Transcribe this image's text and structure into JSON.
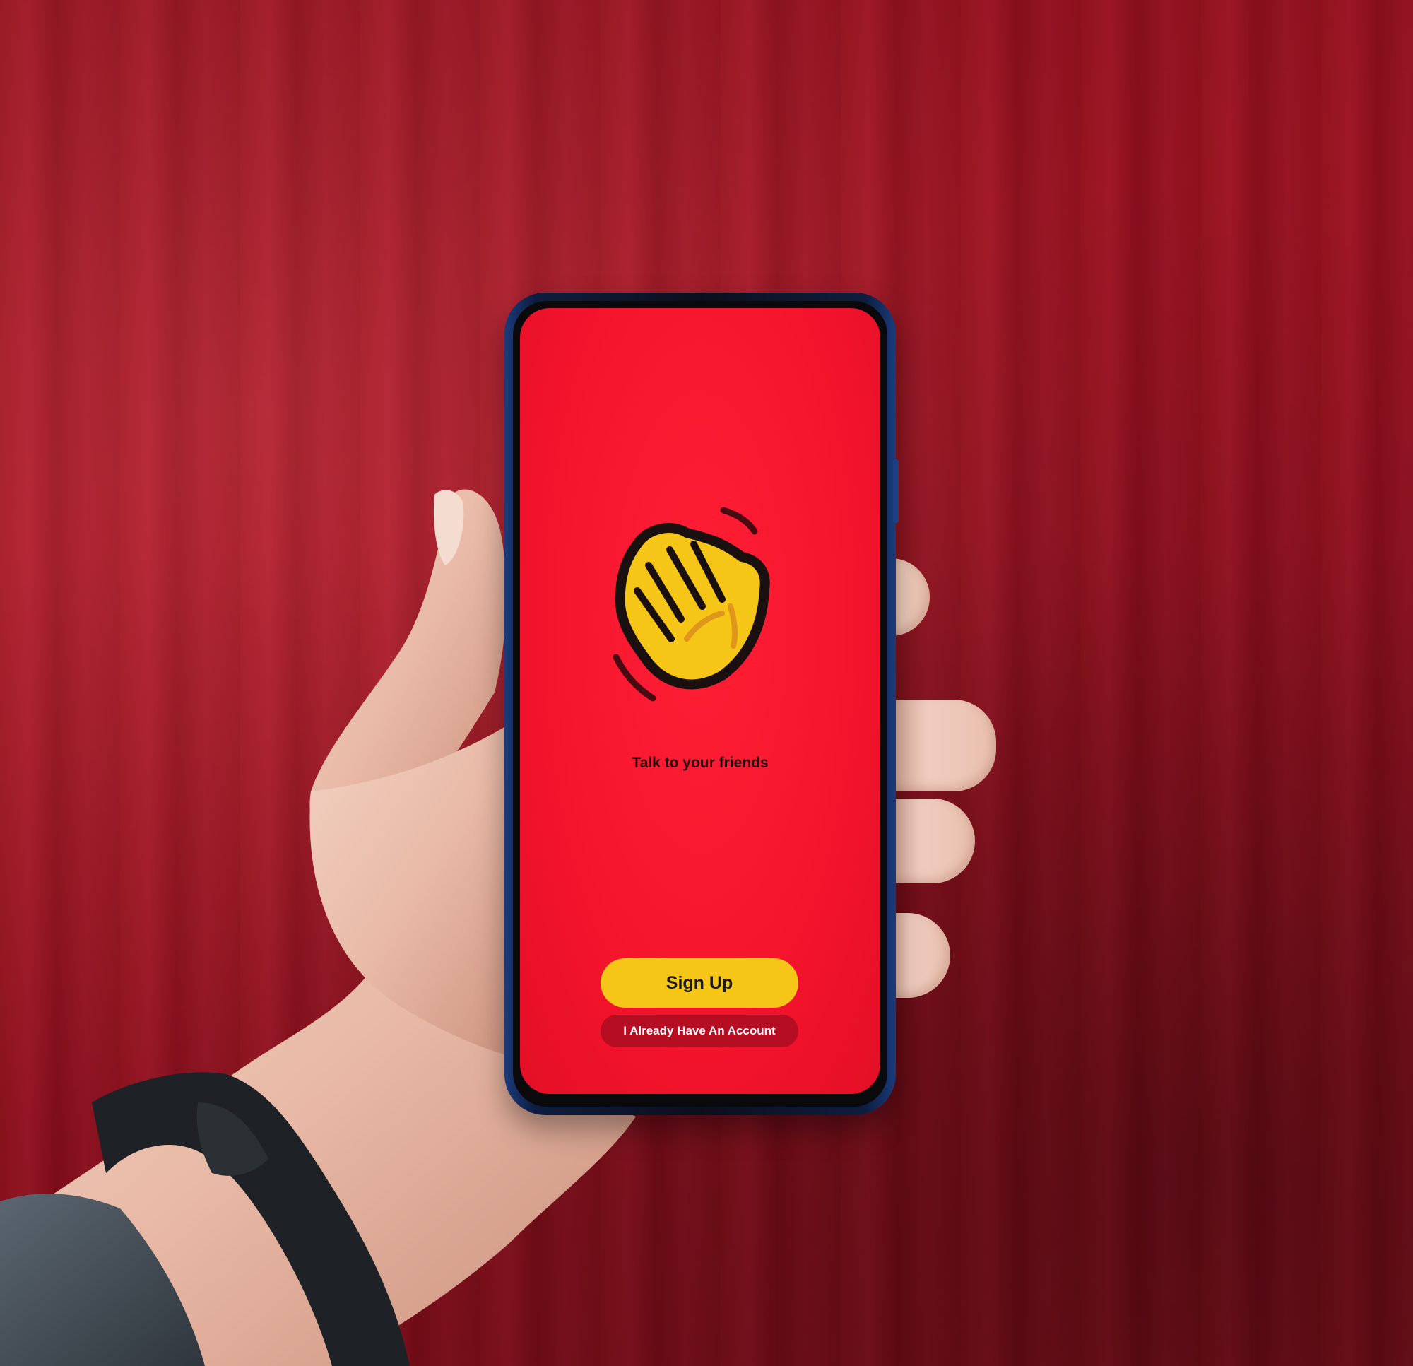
{
  "photo": {
    "subject": "",
    "colors": {
      "wall": "#9a1422",
      "screen": "#f4142c",
      "logo_yellow": "#f5c518",
      "secondary_button": "#b50d22",
      "phone_frame": "#1a3b7a"
    }
  },
  "app_screen": {
    "logo_icon": "waving-hand-icon",
    "tagline": "Talk to your friends",
    "primary_button": "Sign Up",
    "secondary_button": "I Already Have An Account"
  }
}
